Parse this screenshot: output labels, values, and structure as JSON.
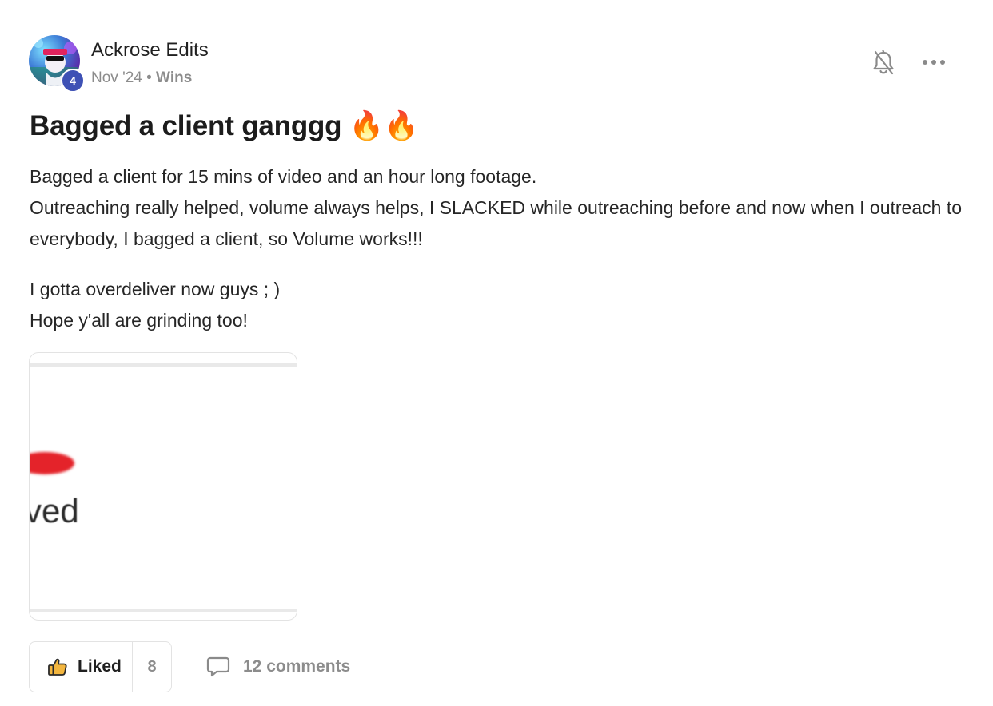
{
  "post": {
    "author": {
      "name": "Ackrose Edits",
      "level": "4"
    },
    "meta": {
      "date": "Nov '24",
      "separator": "•",
      "category": "Wins"
    },
    "icons": {
      "bell": "bell-off-icon",
      "more": "more-horizontal-icon",
      "like": "thumbs-up-icon",
      "comment": "comment-icon"
    },
    "title": "Bagged a client ganggg 🔥🔥",
    "body": [
      "Bagged a client for 15 mins of video and an hour long footage.\nOutreaching really helped, volume always helps, I SLACKED while outreaching before and now when I outreach to everybody, I bagged a client, so Volume works!!!",
      "I gotta overdeliver now guys ; )\nHope y'all are grinding too!"
    ],
    "attachment": {
      "visible_text": "ved"
    },
    "actions": {
      "like_label": "Liked",
      "like_count": "8",
      "comments_label": "12 comments"
    },
    "colors": {
      "badge": "#3e51b5",
      "muted_text": "#8c8c8c",
      "border": "#e3e3e3",
      "like_icon": "#f3b63f"
    }
  }
}
